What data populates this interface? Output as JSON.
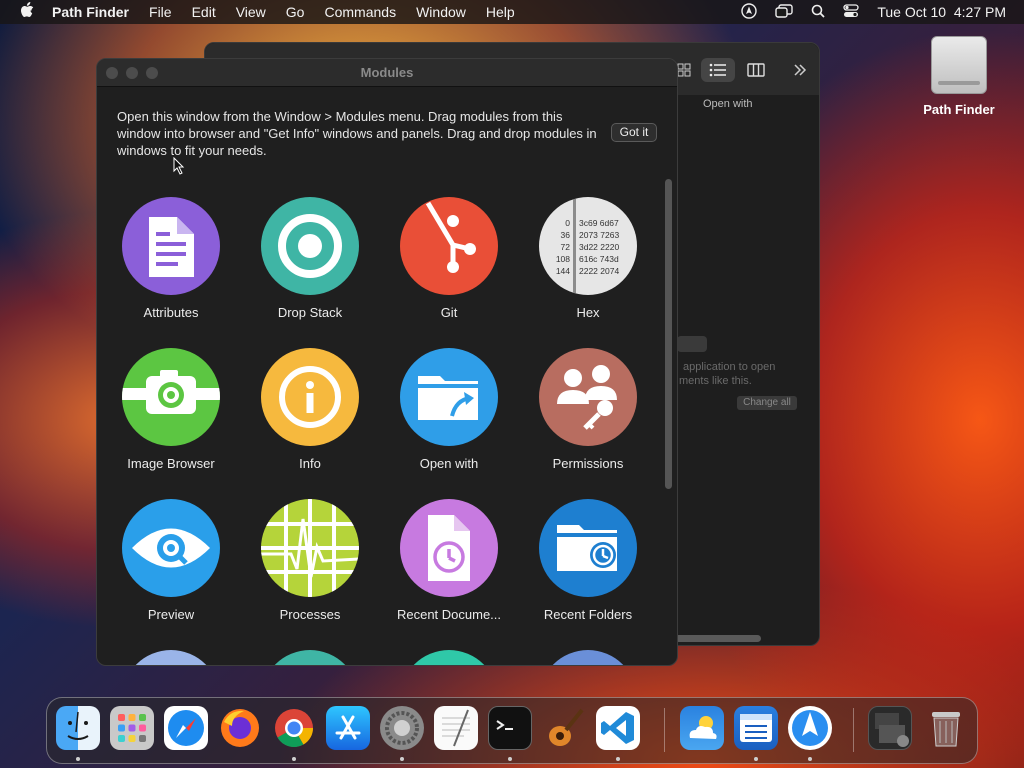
{
  "menubar": {
    "apple_icon": "apple-icon",
    "app_name": "Path Finder",
    "menus": [
      "File",
      "Edit",
      "View",
      "Go",
      "Commands",
      "Window",
      "Help"
    ],
    "clock": "Tue Oct 10  4:27 PM",
    "status_icons": [
      "location-icon",
      "screen-mirror-icon",
      "spotlight-search-icon",
      "control-center-icon"
    ]
  },
  "desktop": {
    "drive_label": "Path Finder"
  },
  "back_window": {
    "open_with_label": "Open with",
    "hint_line1": "application to open",
    "hint_line2": "ments like this.",
    "change_all": "Change all"
  },
  "modules_window": {
    "title": "Modules",
    "intro": "Open this window from the Window > Modules menu. Drag modules from this window into browser and \"Get Info\" windows and panels. Drag and drop modules in windows to fit your needs.",
    "got_it": "Got it",
    "modules": [
      {
        "label": "Attributes",
        "color": "#8b5fd9",
        "icon": "attributes-icon"
      },
      {
        "label": "Drop Stack",
        "color": "#3fb5a5",
        "icon": "drop-stack-icon"
      },
      {
        "label": "Git",
        "color": "#e94f37",
        "icon": "git-icon"
      },
      {
        "label": "Hex",
        "color": "#e6e6e6",
        "icon": "hex-icon"
      },
      {
        "label": "Image Browser",
        "color": "#5cc642",
        "icon": "image-browser-icon"
      },
      {
        "label": "Info",
        "color": "#f6b93e",
        "icon": "info-icon"
      },
      {
        "label": "Open with",
        "color": "#2f9ee8",
        "icon": "open-with-icon"
      },
      {
        "label": "Permissions",
        "color": "#b86d60",
        "icon": "permissions-icon"
      },
      {
        "label": "Preview",
        "color": "#2a9fea",
        "icon": "preview-icon"
      },
      {
        "label": "Processes",
        "color": "#b5d43a",
        "icon": "processes-icon"
      },
      {
        "label": "Recent Docume...",
        "color": "#c77ae0",
        "icon": "recent-documents-icon"
      },
      {
        "label": "Recent Folders",
        "color": "#1e7fd0",
        "icon": "recent-folders-icon"
      }
    ],
    "hex_rows": [
      [
        "0",
        "3c69 6d67"
      ],
      [
        "36",
        "2073 7263"
      ],
      [
        "72",
        "3d22 2220"
      ],
      [
        "108",
        "616c 743d"
      ],
      [
        "144",
        "2222 2074"
      ]
    ]
  },
  "dock": {
    "apps": [
      "Finder",
      "Launchpad",
      "Safari",
      "Firefox",
      "Google Chrome",
      "App Store",
      "System Settings",
      "TextEdit",
      "Terminal",
      "GarageBand",
      "Visual Studio Code",
      "Weather",
      "Path Finder",
      "Path Finder Browser",
      "Screenshot",
      "Trash"
    ]
  }
}
